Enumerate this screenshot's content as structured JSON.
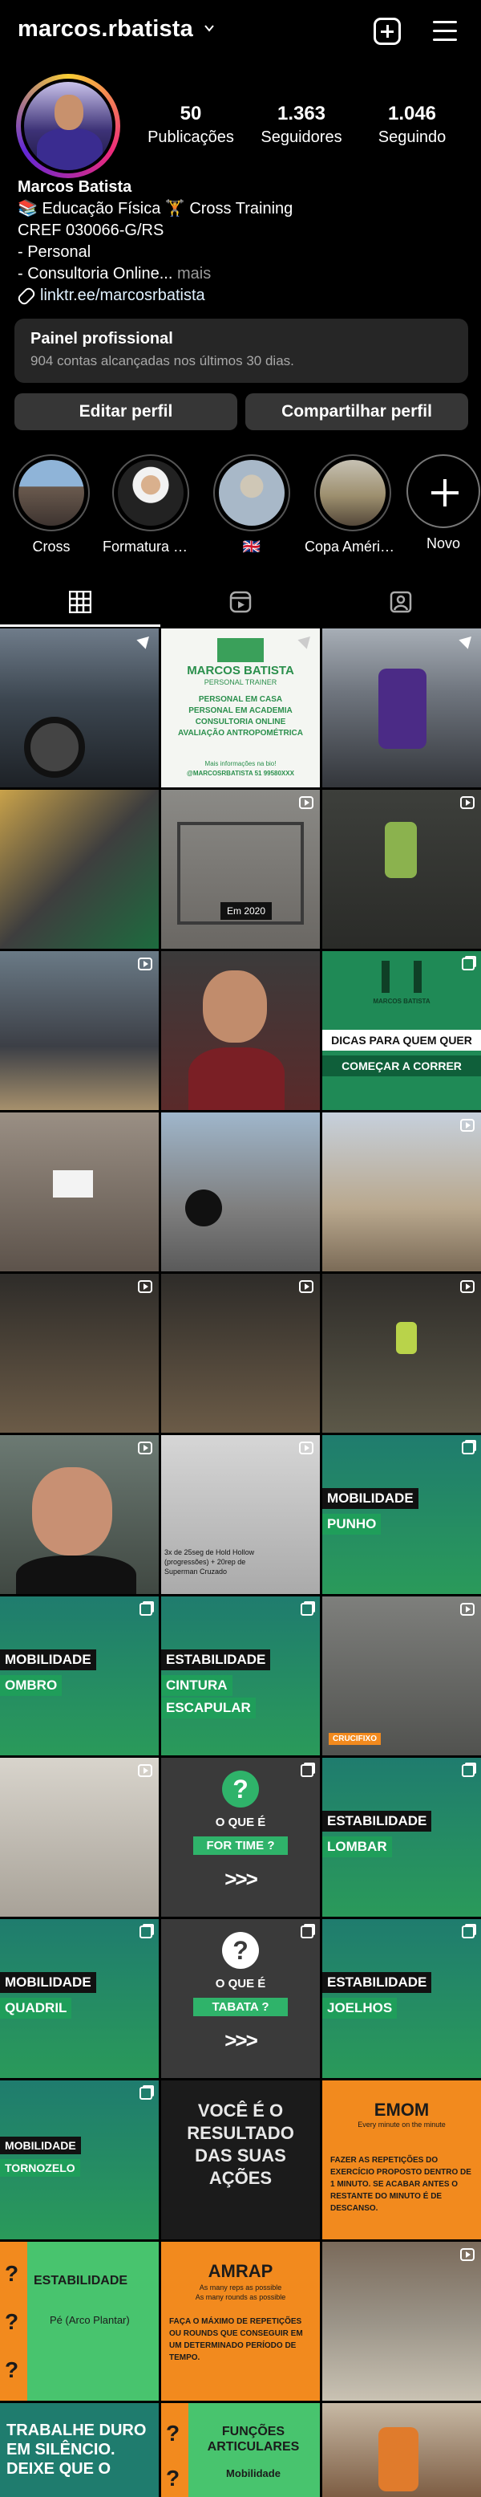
{
  "header": {
    "username": "marcos.rbatista",
    "icons": [
      "chevron-down-icon",
      "add-icon",
      "menu-icon"
    ]
  },
  "profile": {
    "stats": [
      {
        "value": "50",
        "label": "Publicações"
      },
      {
        "value": "1.363",
        "label": "Seguidores"
      },
      {
        "value": "1.046",
        "label": "Seguindo"
      }
    ],
    "bio": {
      "name": "Marcos Batista",
      "line1": "📚 Educação Física 🏋 Cross Training",
      "line2": "CREF 030066-G/RS",
      "line3": "- Personal",
      "line4": "- Consultoria Online...",
      "more": " mais",
      "link": "linktr.ee/marcosrbatista"
    },
    "panel": {
      "title": "Painel profissional",
      "subtitle": "904 contas alcançadas nos últimos 30 dias."
    },
    "buttons": {
      "edit": "Editar perfil",
      "share": "Compartilhar perfil"
    }
  },
  "highlights": [
    {
      "label": "Cross"
    },
    {
      "label": "Formatura 📚..."
    },
    {
      "label": "🇬🇧"
    },
    {
      "label": "Copa América..."
    },
    {
      "label": "Novo"
    }
  ],
  "tabs": [
    "grid-icon",
    "reels-icon",
    "tagged-icon"
  ],
  "posts": {
    "p2": {
      "title": "MARCOS BATISTA",
      "subtitle": "PERSONAL TRAINER",
      "lines": [
        "PERSONAL EM CASA",
        "PERSONAL EM ACADEMIA",
        "CONSULTORIA ONLINE",
        "AVALIAÇÃO ANTROPOMÉTRICA"
      ],
      "footer1": "Mais informações na bio!",
      "footer2": "@MARCOSRBATISTA 51 99580XXX"
    },
    "p5": {
      "caption": "Em 2020"
    },
    "p9": {
      "brand": "MARCOS BATISTA",
      "line1": "DICAS PARA QUEM QUER",
      "line2": "COMEÇAR A CORRER"
    },
    "p17": {
      "caption": "3x de 25seg de Hold Hollow (progressões) + 20rep de Superman Cruzado"
    },
    "p18": {
      "label1": "MOBILIDADE",
      "label2": "PUNHO"
    },
    "p19": {
      "label1": "MOBILIDADE",
      "label2": "OMBRO"
    },
    "p20": {
      "label1": "ESTABILIDADE",
      "label2": "CINTURA",
      "label3": "ESCAPULAR"
    },
    "p21": {
      "label": "CRUCIFIXO"
    },
    "p23": {
      "q": "?",
      "label1": "O QUE É",
      "label2": "FOR TIME ?",
      "arrows": ">>>"
    },
    "p24": {
      "label1": "ESTABILIDADE",
      "label2": "LOMBAR"
    },
    "p25": {
      "label1": "MOBILIDADE",
      "label2": "QUADRIL"
    },
    "p26": {
      "q": "?",
      "label1": "O QUE É",
      "label2": "TABATA ?",
      "arrows": ">>>"
    },
    "p27": {
      "label1": "ESTABILIDADE",
      "label2": "JOELHOS"
    },
    "p28": {
      "label1": "MOBILIDADE",
      "label2": "TORNOZELO"
    },
    "p29": {
      "text": "VOCÊ É O RESULTADO DAS SUAS AÇÕES"
    },
    "p30": {
      "title": "EMOM",
      "subtitle": "Every minute on the minute",
      "body": "FAZER AS REPETIÇÕES DO EXERCÍCIO PROPOSTO DENTRO DE 1 MINUTO. SE ACABAR ANTES O RESTANTE DO MINUTO É DE DESCANSO."
    },
    "p31": {
      "title": "ESTABILIDADE",
      "subtitle": "Pé (Arco Plantar)"
    },
    "p32": {
      "title": "AMRAP",
      "sub1": "As many reps as possible",
      "sub2": "As many rounds as possible",
      "body": "FAÇA O MÁXIMO DE REPETIÇÕES OU ROUNDS QUE CONSEGUIR EM UM DETERMINADO PERÍODO DE TEMPO."
    },
    "p34": {
      "text": "TRABALHE DURO EM SILÊNCIO. DEIXE QUE O"
    },
    "p35": {
      "title": "FUNÇÕES ARTICULARES",
      "sub": "Mobilidade"
    }
  },
  "colors": {
    "accent_green": "#1f9e5a",
    "teal": "#1f7c6e",
    "orange": "#f28a1e",
    "panel": "#262626",
    "button": "#363636"
  }
}
